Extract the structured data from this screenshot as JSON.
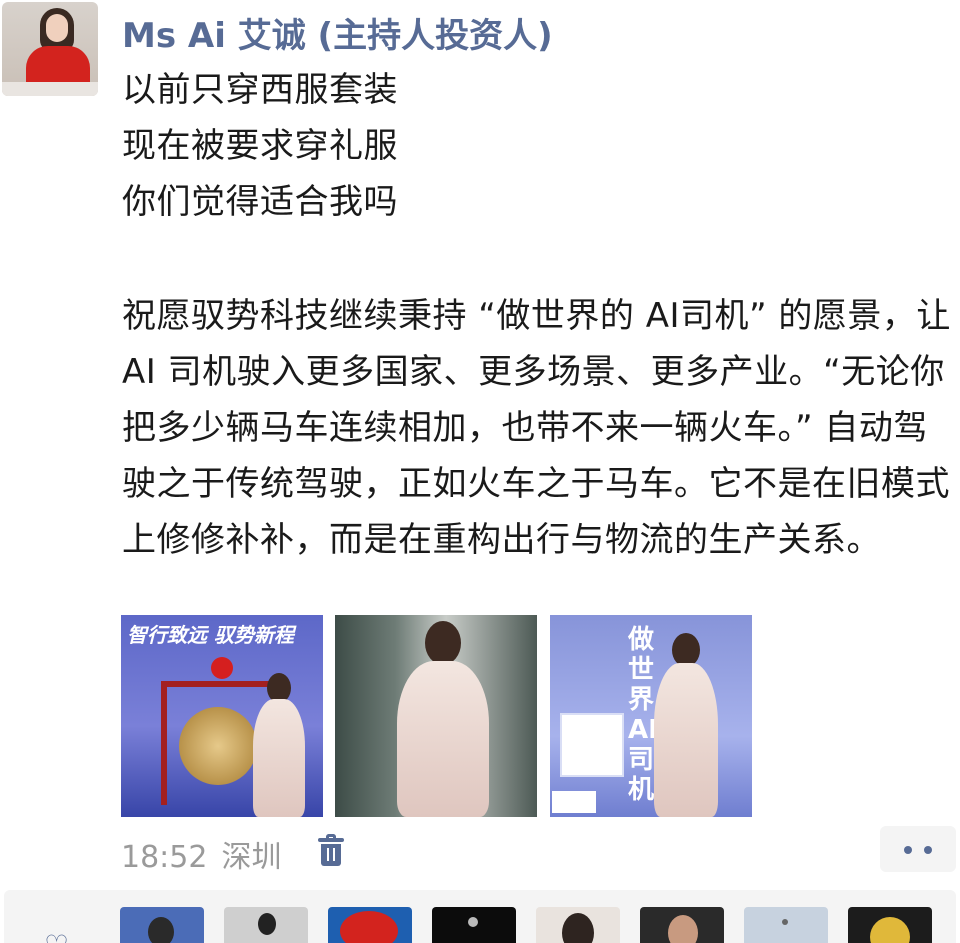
{
  "post": {
    "author": "Ms Ai 艾诚 (主持人投资人)",
    "lines": [
      "以前只穿西服套装",
      "现在被要求穿礼服",
      "你们觉得适合我吗"
    ],
    "paragraph": "祝愿驭势科技继续秉持 “做世界的 AI司机” 的愿景，让 AI 司机驶入更多国家、更多场景、更多产业。“无论你把多少辆马车连续相加，也带不来一辆火车。” 自动驾驶之于传统驾驶，正如火车之于马车。它不是在旧模式上修修补补，而是在重构出行与物流的生产关系。"
  },
  "photos": {
    "p1_banner": "智行致远  驭势新程",
    "p3_sign": "做世界AI司机"
  },
  "meta": {
    "time": "18:52",
    "location": "深圳"
  },
  "icons": {
    "delete": "trash-icon",
    "more": "more-dots-icon",
    "like": "heart-icon"
  },
  "colors": {
    "link": "#576b95",
    "meta": "#9a9a9a",
    "panel": "#f4f4f4"
  }
}
